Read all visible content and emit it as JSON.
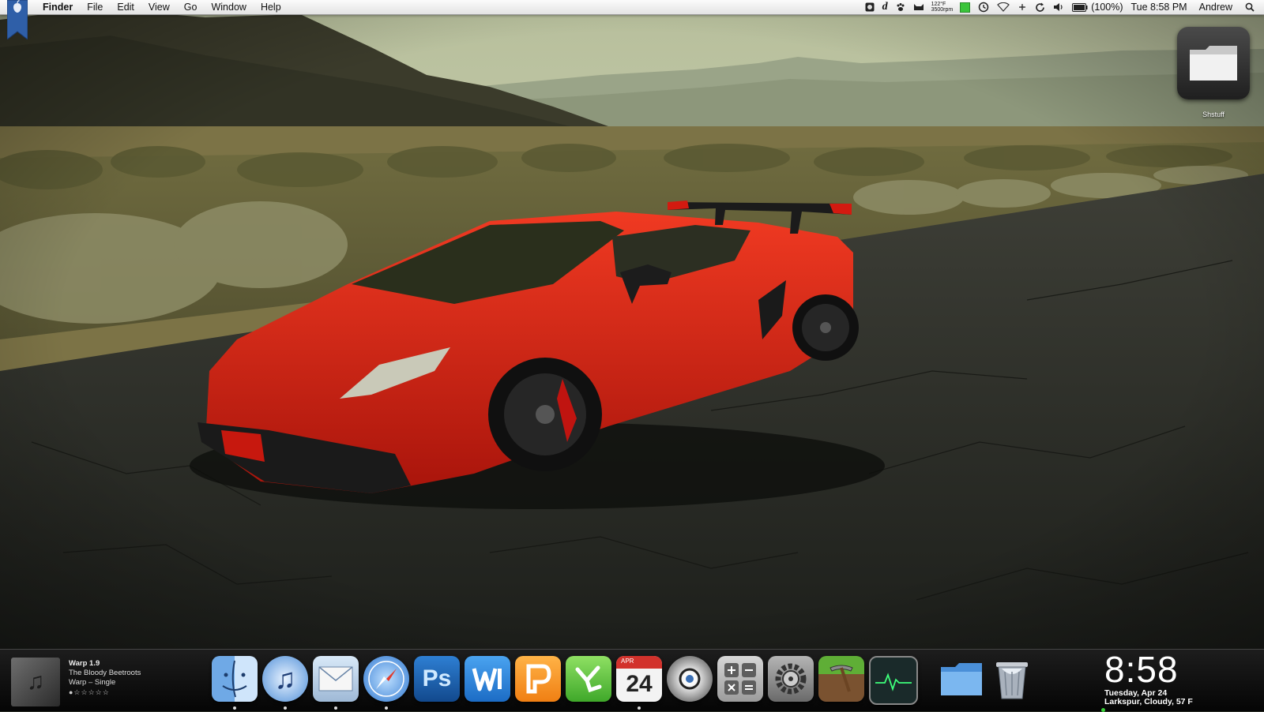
{
  "menubar": {
    "app_name": "Finder",
    "menus": [
      "File",
      "Edit",
      "View",
      "Go",
      "Window",
      "Help"
    ],
    "status": {
      "temp": "122°F",
      "fan": "3500rpm",
      "battery": "(100%)",
      "clock": "Tue 8:58 PM",
      "user": "Andrew"
    }
  },
  "desktop": {
    "folder_label": "Shstuff"
  },
  "now_playing": {
    "app": "Warp 1.9",
    "artist": "The Bloody Beetroots",
    "album": "Warp – Single",
    "rating_text": "●☆☆☆☆☆"
  },
  "dock": {
    "items": [
      {
        "name": "finder",
        "running": true
      },
      {
        "name": "itunes",
        "running": true
      },
      {
        "name": "mail",
        "running": true
      },
      {
        "name": "safari",
        "running": true
      },
      {
        "name": "photoshop",
        "running": false,
        "label": "Ps"
      },
      {
        "name": "word",
        "running": false
      },
      {
        "name": "pages",
        "running": false
      },
      {
        "name": "numbers",
        "running": false
      },
      {
        "name": "ical",
        "running": true,
        "month": "APR",
        "day": "24"
      },
      {
        "name": "dvd-player",
        "running": false
      },
      {
        "name": "calculator",
        "running": false
      },
      {
        "name": "system-preferences",
        "running": false
      },
      {
        "name": "minecraft",
        "running": false
      },
      {
        "name": "activity-monitor",
        "running": false
      },
      {
        "name": "documents-folder",
        "running": false
      },
      {
        "name": "trash",
        "running": false
      }
    ]
  },
  "clock_widget": {
    "time": "8:58",
    "date": "Tuesday, Apr 24",
    "weather": "Larkspur, Cloudy, 57 F"
  },
  "colors": {
    "car_red": "#d81e12",
    "sky": "#c9cfb2",
    "road": "#2c2e2a"
  }
}
